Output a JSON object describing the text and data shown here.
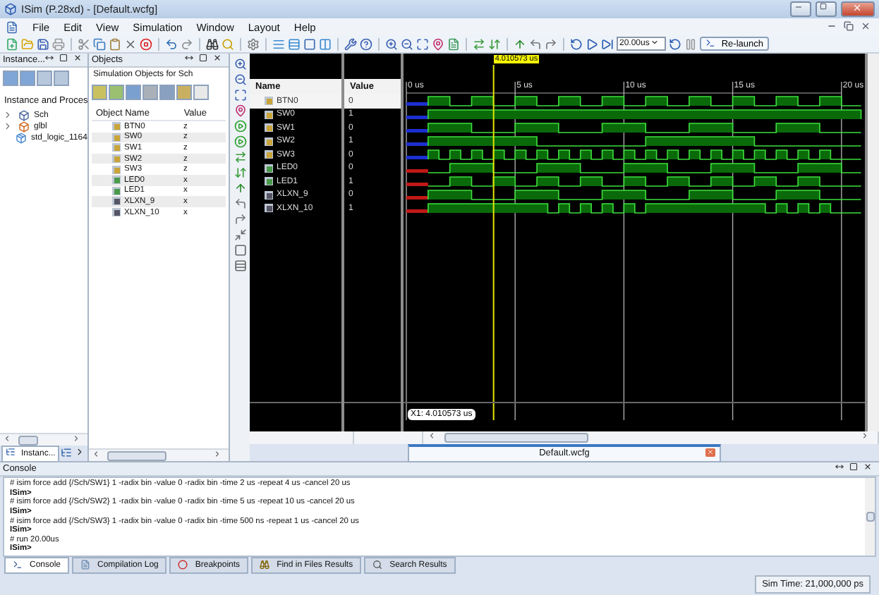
{
  "window": {
    "title": "ISim (P.28xd) - [Default.wcfg]"
  },
  "menu": [
    "File",
    "Edit",
    "View",
    "Simulation",
    "Window",
    "Layout",
    "Help"
  ],
  "toolbar": {
    "run_time": "20.00us",
    "relaunch": "Re-launch"
  },
  "instance_panel": {
    "title": "Instance...",
    "heading": "Instance and Proces",
    "tab": "Instanc...",
    "tree": [
      {
        "label": "Sch",
        "kind": "module",
        "expanded": false
      },
      {
        "label": "glbl",
        "kind": "module",
        "expanded": false
      },
      {
        "label": "std_logic_1164",
        "kind": "package"
      }
    ]
  },
  "objects_panel": {
    "title": "Objects",
    "subtitle": "Simulation Objects for Sch",
    "columns": [
      "Object Name",
      "Value"
    ],
    "rows": [
      {
        "name": "BTN0",
        "value": "z",
        "kind": "input"
      },
      {
        "name": "SW0",
        "value": "z",
        "kind": "input"
      },
      {
        "name": "SW1",
        "value": "z",
        "kind": "input"
      },
      {
        "name": "SW2",
        "value": "z",
        "kind": "input"
      },
      {
        "name": "SW3",
        "value": "z",
        "kind": "input"
      },
      {
        "name": "LED0",
        "value": "x",
        "kind": "output"
      },
      {
        "name": "LED1",
        "value": "x",
        "kind": "output"
      },
      {
        "name": "XLXN_9",
        "value": "x",
        "kind": "wire"
      },
      {
        "name": "XLXN_10",
        "value": "x",
        "kind": "wire"
      }
    ]
  },
  "wave": {
    "cursor_time": "4.010573 us",
    "columns": [
      "Name",
      "Value"
    ],
    "ticks": [
      "0 us",
      "5 us",
      "10 us",
      "15 us",
      "20 us"
    ],
    "cursor_label": "X1: 4.010573 us",
    "tab": "Default.wcfg",
    "signals": [
      {
        "name": "BTN0",
        "value": "0",
        "kind": "input",
        "selected": true
      },
      {
        "name": "SW0",
        "value": "1",
        "kind": "input",
        "selected": false
      },
      {
        "name": "SW1",
        "value": "0",
        "kind": "input",
        "selected": false
      },
      {
        "name": "SW2",
        "value": "1",
        "kind": "input",
        "selected": false
      },
      {
        "name": "SW3",
        "value": "0",
        "kind": "input",
        "selected": false
      },
      {
        "name": "LED0",
        "value": "0",
        "kind": "output",
        "selected": false
      },
      {
        "name": "LED1",
        "value": "1",
        "kind": "output",
        "selected": false
      },
      {
        "name": "XLXN_9",
        "value": "0",
        "kind": "wire",
        "selected": false
      },
      {
        "name": "XLXN_10",
        "value": "1",
        "kind": "wire",
        "selected": false
      }
    ]
  },
  "console": {
    "title": "Console",
    "lines": [
      {
        "text": "# isim force add {/Sch/SW1} 1 -radix bin -value 0 -radix bin -time 2 us -repeat 4 us -cancel 20 us",
        "kind": "echo"
      },
      {
        "text": "ISim>",
        "kind": "prompt"
      },
      {
        "text": "# isim force add {/Sch/SW2} 1 -radix bin -value 0 -radix bin -time 5 us -repeat 10 us -cancel 20 us",
        "kind": "echo"
      },
      {
        "text": "ISim>",
        "kind": "prompt"
      },
      {
        "text": "# isim force add {/Sch/SW3} 1 -radix bin -value 0 -radix bin -time 500 ns -repeat 1 us -cancel 20 us",
        "kind": "echo"
      },
      {
        "text": "ISim>",
        "kind": "prompt"
      },
      {
        "text": "# run 20.00us",
        "kind": "echo"
      },
      {
        "text": "ISim>",
        "kind": "prompt"
      }
    ],
    "tabs": [
      {
        "label": "Console",
        "kind": "console",
        "selected": true
      },
      {
        "label": "Compilation Log",
        "kind": "log",
        "selected": false
      },
      {
        "label": "Breakpoints",
        "kind": "breakpoint",
        "selected": false
      },
      {
        "label": "Find in Files Results",
        "kind": "find",
        "selected": false
      },
      {
        "label": "Search Results",
        "kind": "search",
        "selected": false
      }
    ]
  },
  "status": {
    "sim_time": "Sim Time: 21,000,000 ps"
  }
}
